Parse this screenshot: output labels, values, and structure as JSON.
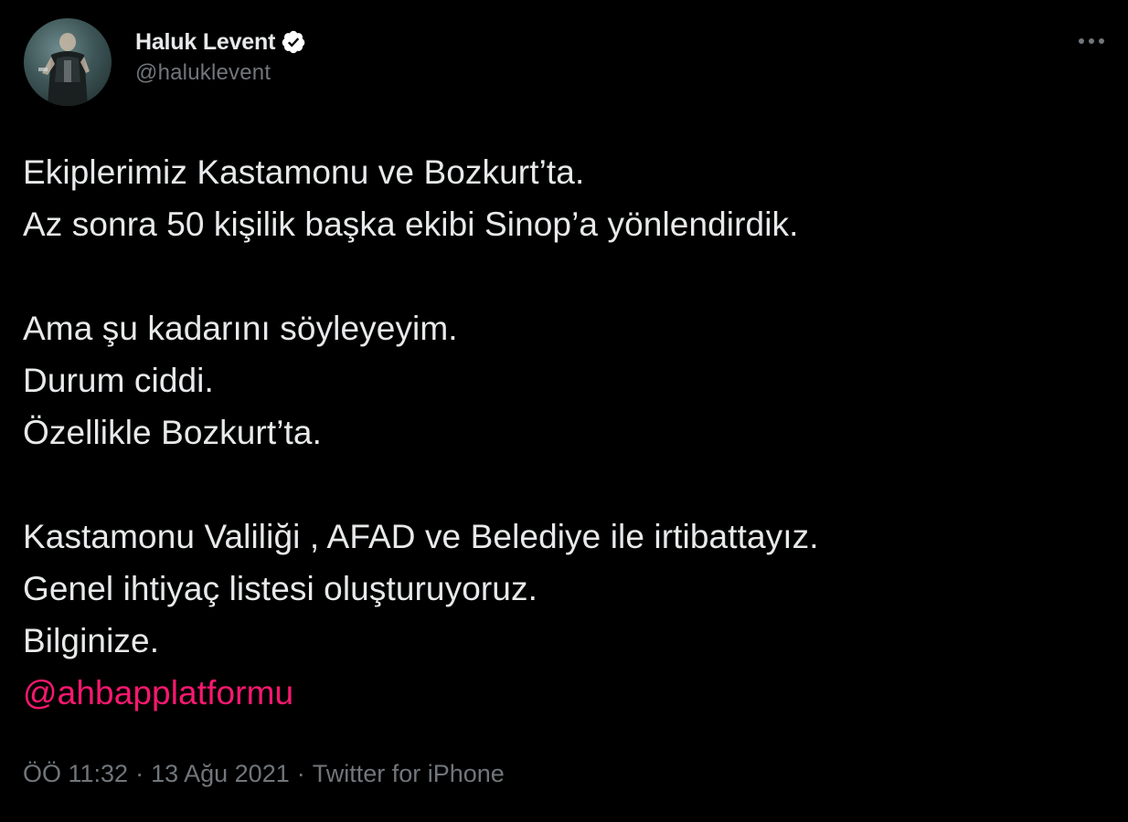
{
  "author": {
    "display_name": "Haluk Levent",
    "handle": "@haluklevent",
    "verified": true,
    "verified_color": "#ffffff"
  },
  "tweet": {
    "paragraphs": [
      [
        "Ekiplerimiz Kastamonu ve Bozkurt’ta.",
        "Az sonra 50 kişilik başka ekibi Sinop’a yönlendirdik."
      ],
      [
        "Ama şu kadarını söyleyeyim.",
        "Durum ciddi.",
        "Özellikle Bozkurt’ta."
      ],
      [
        "Kastamonu Valiliği , AFAD ve Belediye ile irtibattayız.",
        "Genel ihtiyaç listesi oluşturuyoruz.",
        "Bilginize."
      ]
    ],
    "mention": "@ahbapplatformu",
    "mention_color": "#f9186f"
  },
  "meta": {
    "time": "ÖÖ 11:32",
    "separator": "·",
    "date": "13 Ağu 2021",
    "source": "Twitter for iPhone"
  },
  "icons": {
    "more": "more-options-icon",
    "verified": "verified-badge-icon"
  },
  "colors": {
    "background": "#000000",
    "text": "#e7e9ea",
    "secondary": "#71767b"
  }
}
